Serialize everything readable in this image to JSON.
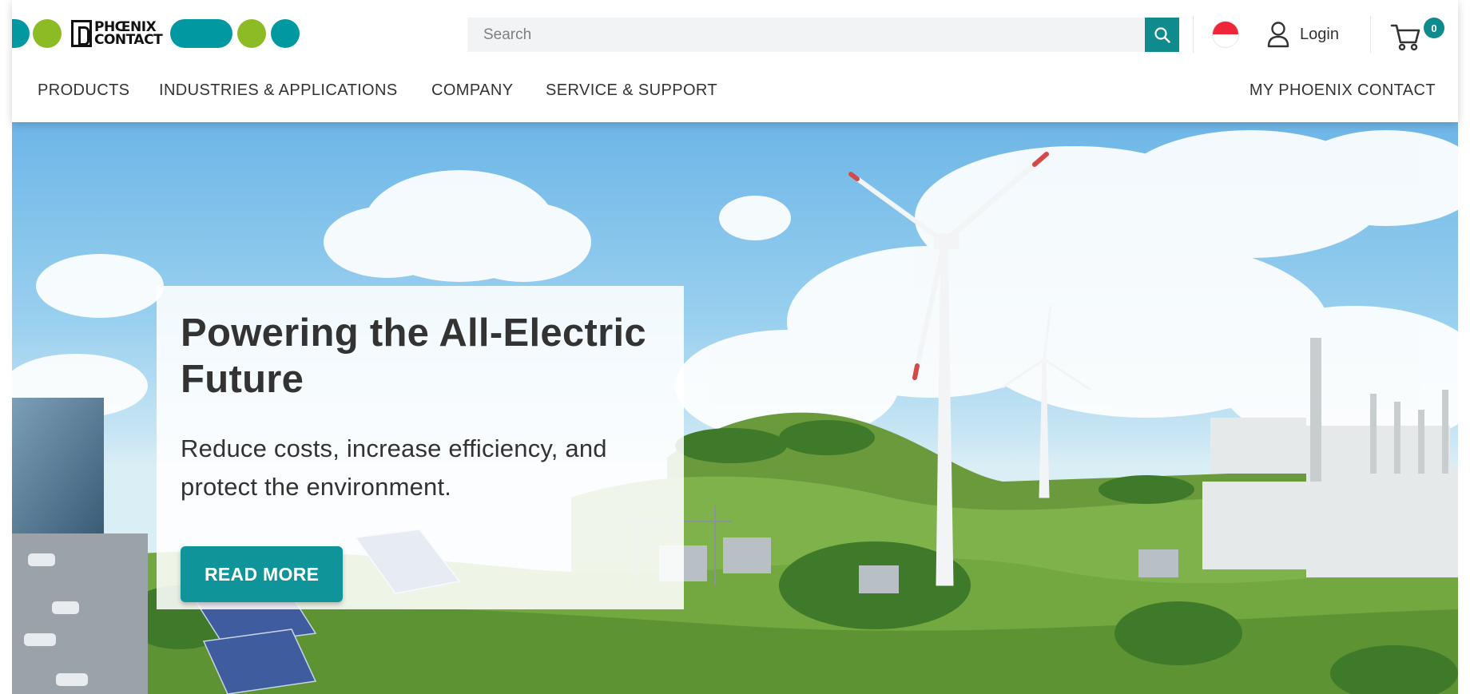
{
  "brand": {
    "logo_text_line1": "PHŒNIX",
    "logo_text_line2": "CONTACT",
    "colors": {
      "teal": "#0098a1",
      "green": "#8cbb23",
      "button_teal": "#0f8b8d"
    }
  },
  "search": {
    "placeholder": "Search",
    "icon": "search-icon"
  },
  "locale": {
    "icon": "singapore-flag-icon"
  },
  "account": {
    "login_label": "Login",
    "icon": "user-icon"
  },
  "cart": {
    "count": "0",
    "icon": "shopping-cart-icon"
  },
  "nav": {
    "items": [
      {
        "label": "PRODUCTS"
      },
      {
        "label": "INDUSTRIES & APPLICATIONS"
      },
      {
        "label": "COMPANY"
      },
      {
        "label": "SERVICE & SUPPORT"
      }
    ],
    "right_label": "MY PHOENIX CONTACT"
  },
  "hero": {
    "title": "Powering the All-Electric Future",
    "subtitle": "Reduce costs, increase efficiency, and protect the environment.",
    "cta_label": "READ MORE",
    "image_subject": "wind turbines, solar panels, substation and industrial plant on green hills"
  }
}
